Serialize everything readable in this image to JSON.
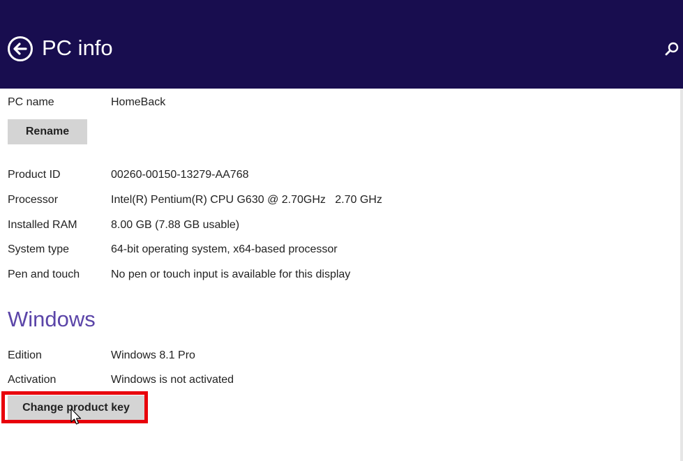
{
  "header": {
    "title": "PC info",
    "background": "#180d4f",
    "back_icon": "back-arrow-circle-icon",
    "search_icon": "search-icon"
  },
  "pc": {
    "name_label": "PC name",
    "name_value": "HomeBack",
    "rename_button": "Rename",
    "details": [
      {
        "label": "Product ID",
        "value": "00260-00150-13279-AA768"
      },
      {
        "label": "Processor",
        "value": "Intel(R) Pentium(R) CPU G630 @ 2.70GHz   2.70 GHz"
      },
      {
        "label": "Installed RAM",
        "value": "8.00 GB (7.88 GB usable)"
      },
      {
        "label": "System type",
        "value": "64-bit operating system, x64-based processor"
      },
      {
        "label": "Pen and touch",
        "value": "No pen or touch input is available for this display"
      }
    ]
  },
  "windows": {
    "heading": "Windows",
    "heading_color": "#5b45a8",
    "edition_label": "Edition",
    "edition_value": "Windows 8.1 Pro",
    "activation_label": "Activation",
    "activation_value": "Windows is not activated",
    "change_key_button": "Change product key"
  },
  "annotation": {
    "highlight_color": "#e8000b"
  }
}
